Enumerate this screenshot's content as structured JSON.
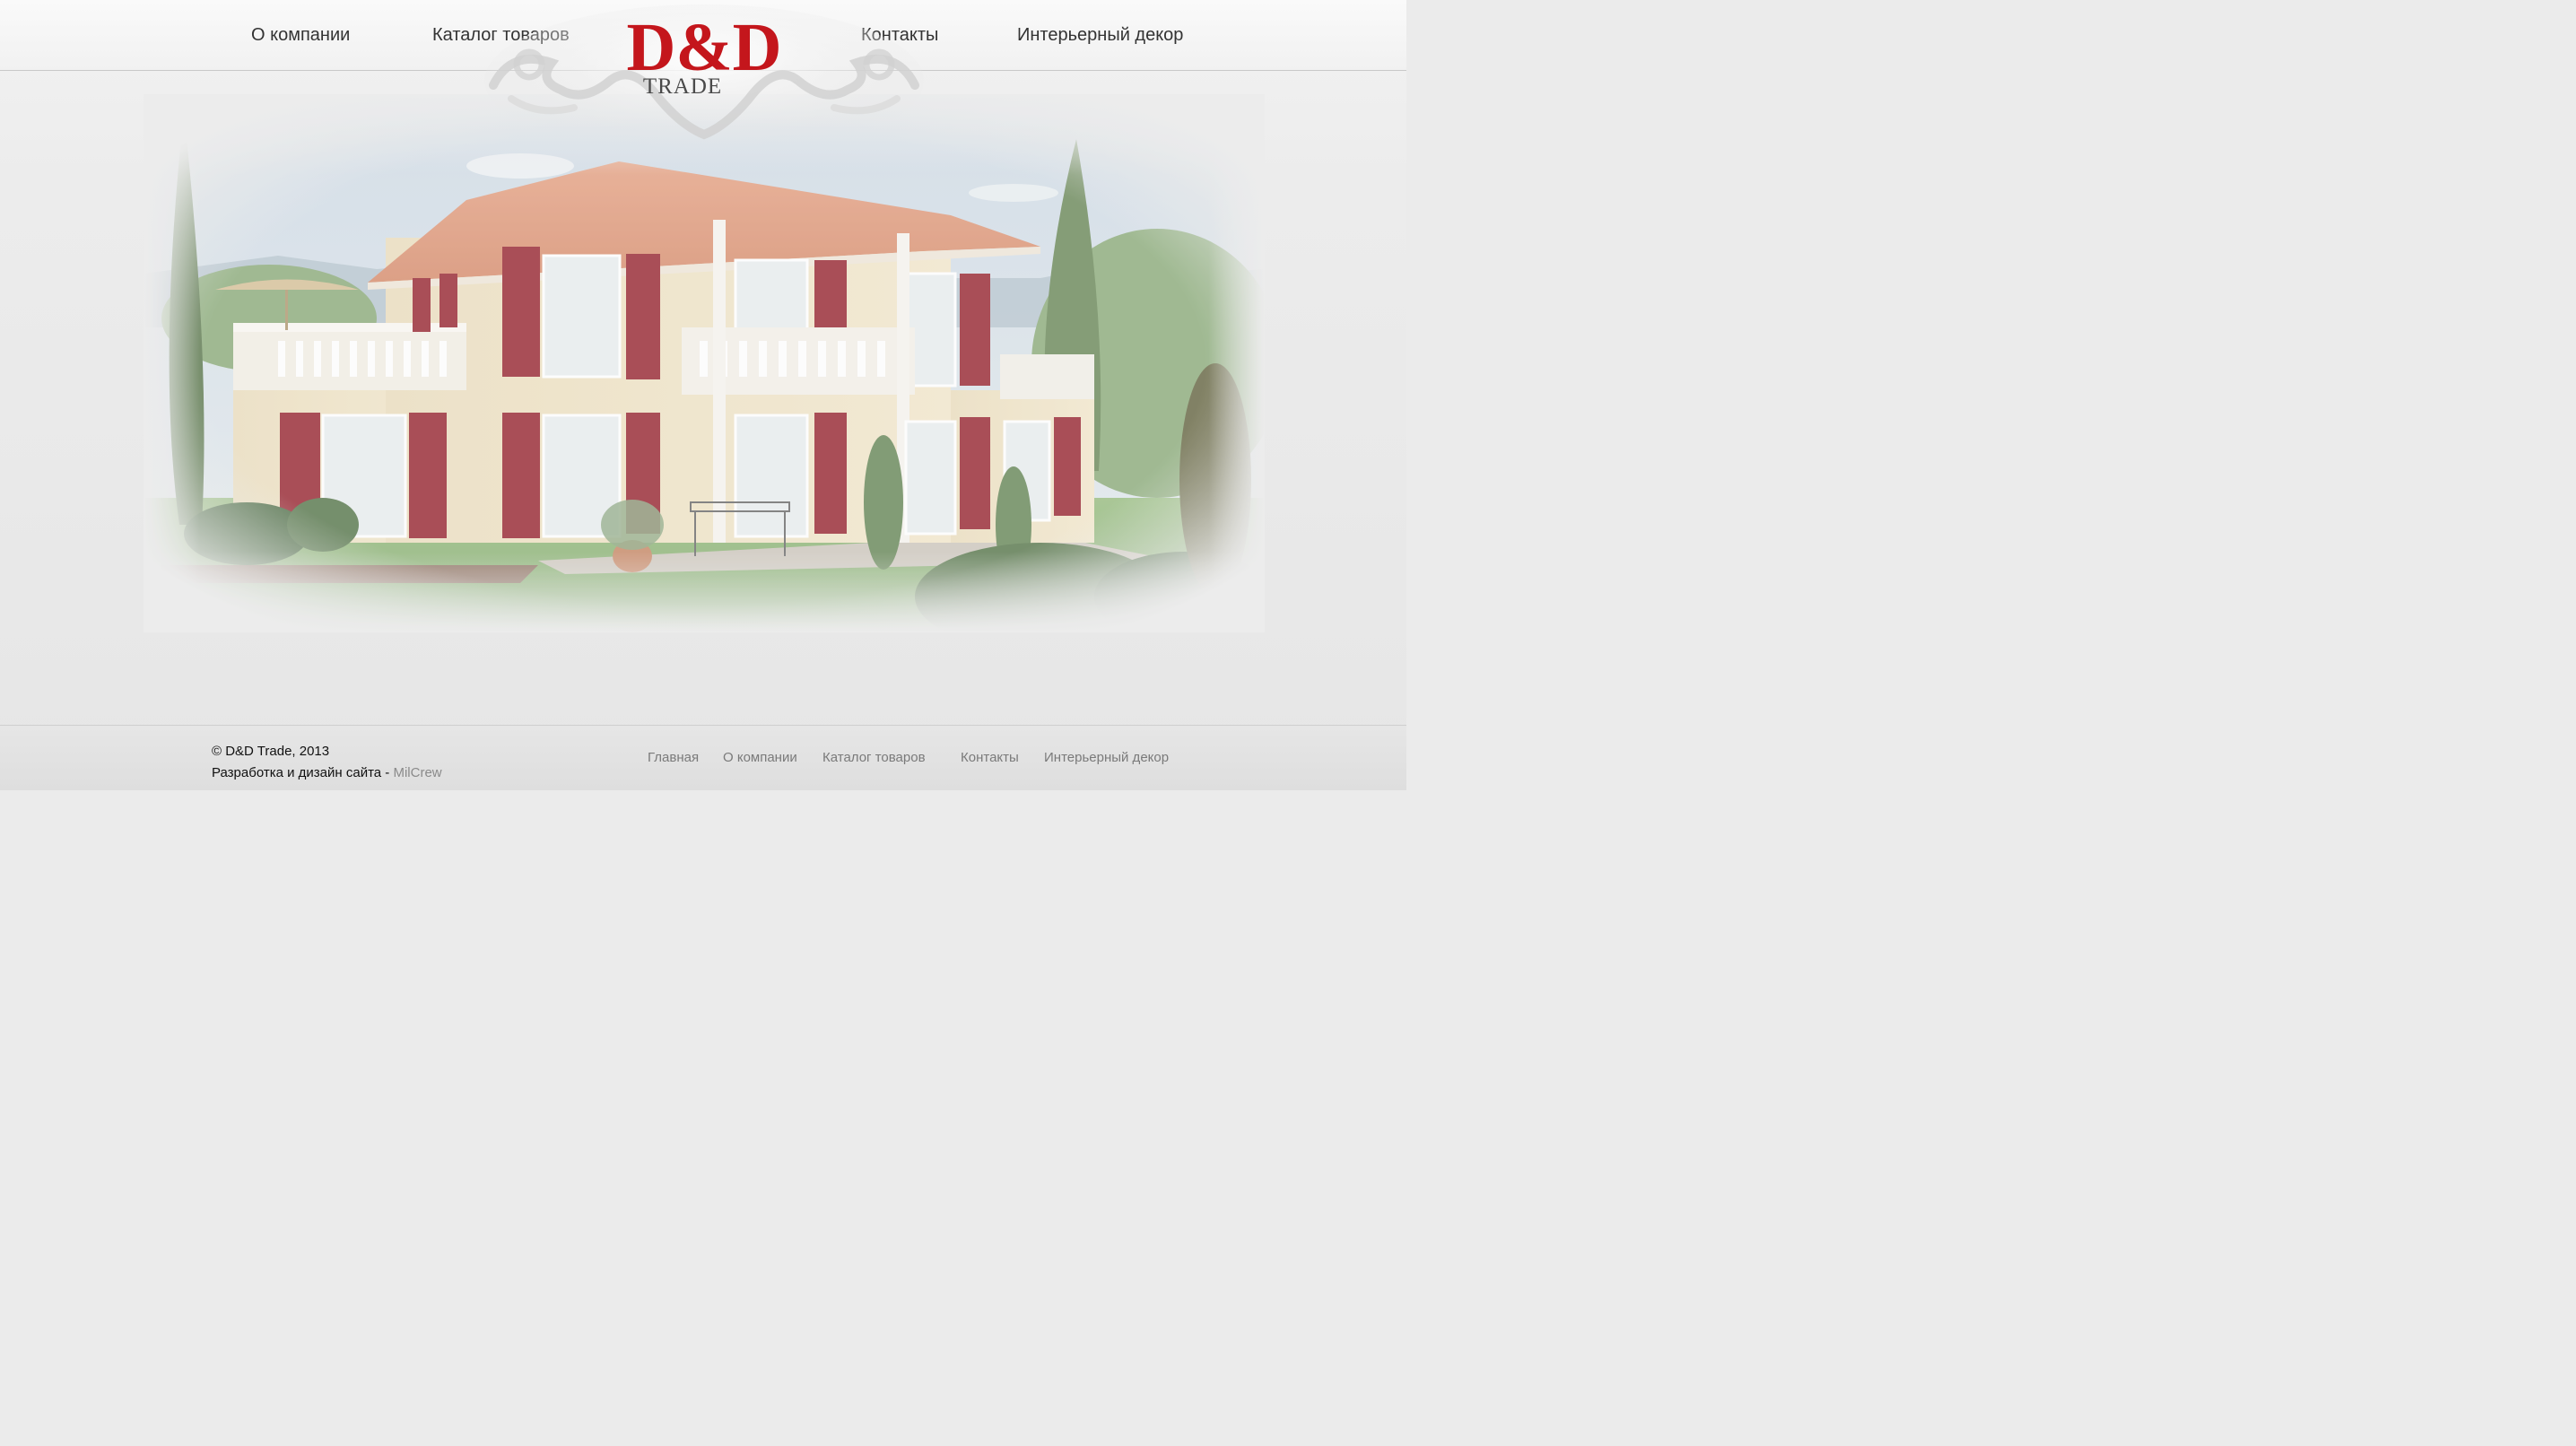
{
  "header": {
    "nav_left": [
      {
        "label": "О компании"
      },
      {
        "label": "Каталог товаров"
      }
    ],
    "nav_right": [
      {
        "label": "Контакты"
      },
      {
        "label": "Интерьерный декор"
      }
    ],
    "logo": {
      "letters": "D&D",
      "subtitle": "TRADE",
      "color": "#c4161c"
    }
  },
  "hero": {
    "image_icon": "villa-illustration"
  },
  "footer": {
    "copyright": "© D&D Trade, 2013",
    "dev_prefix": "Разработка и дизайн сайта - ",
    "dev_link": "MilCrew",
    "links": [
      {
        "label": "Главная"
      },
      {
        "label": "О компании"
      },
      {
        "label": "Каталог товаров"
      },
      {
        "label": "Контакты"
      },
      {
        "label": "Интерьерный декор"
      }
    ]
  }
}
